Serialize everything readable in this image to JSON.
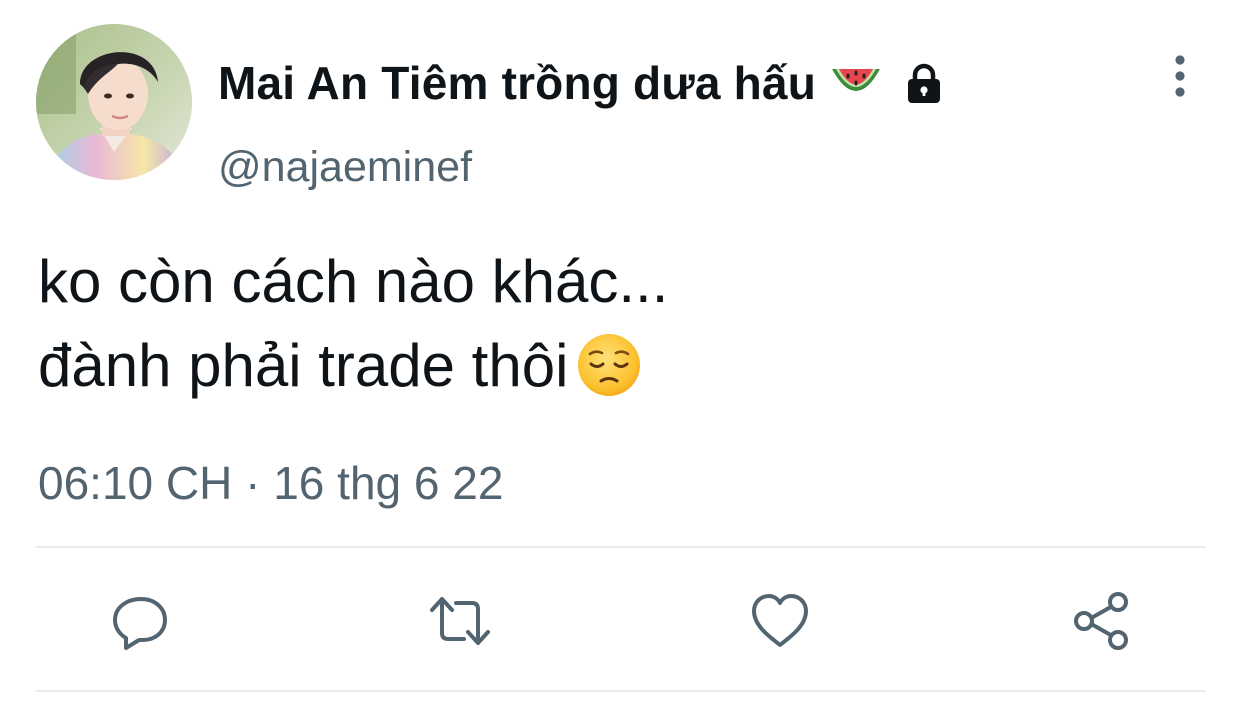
{
  "tweet": {
    "author": {
      "display_name": "Mai An Tiêm trồng dưa hấu",
      "name_emoji": "watermelon-emoji",
      "protected_icon": "lock-icon",
      "handle": "@najaeminef"
    },
    "text_lines": [
      "ko còn cách nào khác...",
      "đành phải trade thôi"
    ],
    "text_emoji": "pensive-face-emoji",
    "timestamp": "06:10 CH · 16 thg 6 22",
    "actions": {
      "reply": "reply-icon",
      "retweet": "retweet-icon",
      "like": "heart-icon",
      "share": "share-icon"
    },
    "menu": "more-vertical-icon"
  },
  "colors": {
    "text": "#0f1419",
    "secondary": "#536471",
    "divider": "#e6ecf0",
    "action_icon": "#536471"
  }
}
